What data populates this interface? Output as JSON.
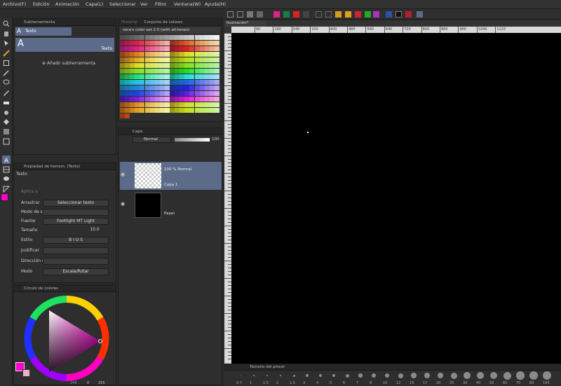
{
  "menu": [
    "Archivo(F)",
    "Edición",
    "Animación",
    "Capa(L)",
    "Seleccionar",
    "Ver",
    "Filtro",
    "Ventana(W)",
    "Ayuda(H)"
  ],
  "subtool": {
    "title": "Subherramienta",
    "tab_label": "Texto",
    "item_label": "Texto",
    "add_label": "Añadir subherramienta"
  },
  "color_set": {
    "tab_history": "Historial",
    "tab_label": "Conjunto de colores",
    "set_name": "sora's color set 2.0 (with all-tones)"
  },
  "layers": {
    "tab_label": "Capa",
    "blend_mode": "Normal",
    "opacity": "100",
    "items": [
      {
        "mode": "100 % Normal",
        "name": "Capa 1"
      },
      {
        "mode": "",
        "name": "Papel"
      }
    ]
  },
  "tool_property": {
    "title": "Propiedad de herram. (Texto)",
    "header": "Texto",
    "apply_label": "Aplica a",
    "rows": [
      {
        "label": "Arrastrar",
        "value": "Seleccionar texto"
      },
      {
        "label": "Modo de selección",
        "value": ""
      },
      {
        "label": "Fuente",
        "value": "Footlight MT Light"
      },
      {
        "label": "Tamaño",
        "value": "10.0"
      },
      {
        "label": "Estilo",
        "value": "B  I  U  S"
      },
      {
        "label": "Justificar",
        "value": ""
      },
      {
        "label": "Dirección de texto",
        "value": ""
      },
      {
        "label": "Modo",
        "value": "Escala/Rotar"
      }
    ]
  },
  "color_wheel": {
    "title": "Círculo de colores",
    "h": "249",
    "s": "0",
    "v": "255",
    "main_color": "#ff00d0",
    "sub_color": "#f0b0c8"
  },
  "canvas": {
    "tab_label": "Ilustración*",
    "ruler_marks": [
      "80",
      "160",
      "240",
      "320",
      "400",
      "480",
      "560",
      "640",
      "720",
      "800",
      "880",
      "960",
      "1040",
      "1120"
    ]
  },
  "brush_size": {
    "title": "Tamaño del pincel",
    "sizes": [
      "0.7",
      "1",
      "1.5",
      "2",
      "2.5",
      "3",
      "4",
      "5",
      "6",
      "7",
      "8",
      "10",
      "12",
      "15",
      "17",
      "20",
      "25",
      "30",
      "40",
      "50",
      "60",
      "70",
      "80",
      "100"
    ]
  },
  "colors": {
    "accent": "#5c6b8a",
    "main": "#ff00d0",
    "sub": "#f0b0c8"
  }
}
